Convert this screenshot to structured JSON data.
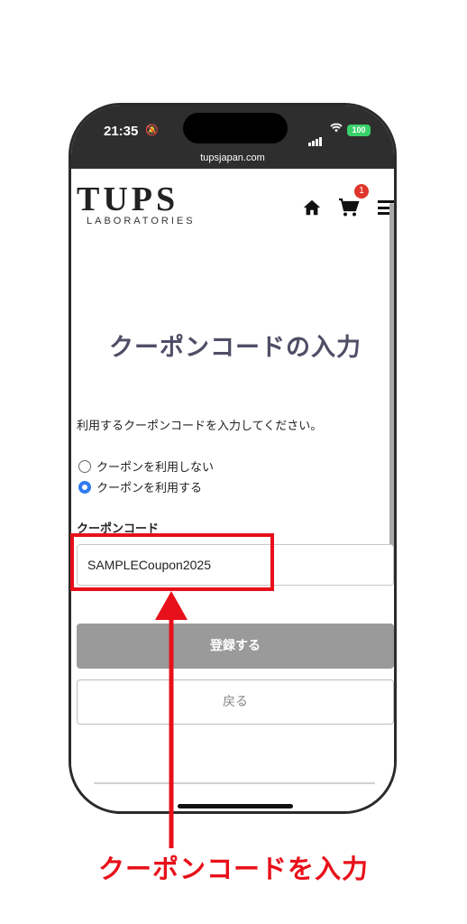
{
  "status_bar": {
    "time": "21:35",
    "battery": "100",
    "url": "tupsjapan.com"
  },
  "header": {
    "logo_main": "TUPS",
    "logo_sub": "LABORATORIES",
    "cart_count": "1",
    "icons": [
      "home-icon",
      "cart-icon",
      "menu-icon"
    ]
  },
  "main": {
    "title": "クーポンコードの入力",
    "instruction": "利用するクーポンコードを入力してください。",
    "options": [
      {
        "label": "クーポンを利用しない",
        "selected": false
      },
      {
        "label": "クーポンを利用する",
        "selected": true
      }
    ],
    "field_label": "クーポンコード",
    "coupon_value": "SAMPLECoupon2025",
    "register_label": "登録する",
    "back_label": "戻る"
  },
  "annotation": {
    "text": "クーポンコードを入力",
    "color": "#e8101a"
  },
  "colors": {
    "accent": "#2f7bf0",
    "title": "#4e4e66",
    "badge": "#e0352b"
  }
}
